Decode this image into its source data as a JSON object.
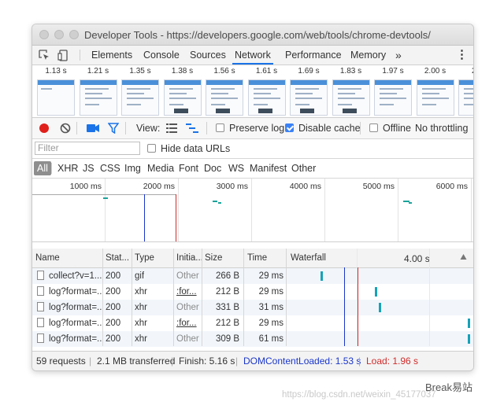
{
  "window": {
    "title": "Developer Tools - https://developers.google.com/web/tools/chrome-devtools/"
  },
  "tabs": {
    "items": [
      "Elements",
      "Console",
      "Sources",
      "Network",
      "Performance",
      "Memory"
    ],
    "active": "Network",
    "more": "»",
    "menu": "⋮"
  },
  "filmstrip": {
    "times": [
      "1.13 s",
      "1.21 s",
      "1.35 s",
      "1.38 s",
      "1.56 s",
      "1.61 s",
      "1.69 s",
      "1.83 s",
      "1.97 s",
      "2.00 s",
      "2.0"
    ]
  },
  "toolbar": {
    "view_label": "View:",
    "preserve_log": {
      "label": "Preserve log",
      "checked": false
    },
    "disable_cache": {
      "label": "Disable cache",
      "checked": true
    },
    "offline": {
      "label": "Offline",
      "checked": false
    },
    "throttling": "No throttling",
    "record_color": "#e0201b",
    "accent_color": "#1a73e8"
  },
  "filter": {
    "placeholder": "Filter",
    "hide_data_urls": {
      "label": "Hide data URLs",
      "checked": false
    }
  },
  "types": [
    "All",
    "XHR",
    "JS",
    "CSS",
    "Img",
    "Media",
    "Font",
    "Doc",
    "WS",
    "Manifest",
    "Other"
  ],
  "overview": {
    "labels": [
      "1000 ms",
      "2000 ms",
      "3000 ms",
      "4000 ms",
      "5000 ms",
      "6000 ms"
    ]
  },
  "table": {
    "headers": {
      "name": "Name",
      "status": "Stat...",
      "type": "Type",
      "initiator": "Initia...",
      "size": "Size",
      "time": "Time",
      "waterfall": "Waterfall",
      "waterfall_time": "4.00 s"
    },
    "rows": [
      {
        "name": "collect?v=1...",
        "status": "200",
        "type": "gif",
        "initiator": "Other",
        "initiator_link": false,
        "size": "266 B",
        "time": "29 ms",
        "bar": 0.18
      },
      {
        "name": "log?format=...",
        "status": "200",
        "type": "xhr",
        "initiator": ":for...",
        "initiator_link": true,
        "size": "212 B",
        "time": "29 ms",
        "bar": 0.48
      },
      {
        "name": "log?format=...",
        "status": "200",
        "type": "xhr",
        "initiator": "Other",
        "initiator_link": false,
        "size": "331 B",
        "time": "31 ms",
        "bar": 0.5
      },
      {
        "name": "log?format=...",
        "status": "200",
        "type": "xhr",
        "initiator": ":for...",
        "initiator_link": true,
        "size": "212 B",
        "time": "29 ms",
        "bar": 0.99
      },
      {
        "name": "log?format=...",
        "status": "200",
        "type": "xhr",
        "initiator": "Other",
        "initiator_link": false,
        "size": "309 B",
        "time": "61 ms",
        "bar": 1.0
      }
    ]
  },
  "status": {
    "requests": "59 requests",
    "transferred": "2.1 MB transferred",
    "finish": "Finish: 5.16 s",
    "dom_content_loaded": "DOMContentLoaded: 1.53 s",
    "load": "Load: 1.96 s",
    "dcl_color": "#1a36c9",
    "load_color": "#d12b2b"
  },
  "watermark": {
    "url": "https://blog.csdn.net/weixin_45177037",
    "brand": "Break易站"
  }
}
